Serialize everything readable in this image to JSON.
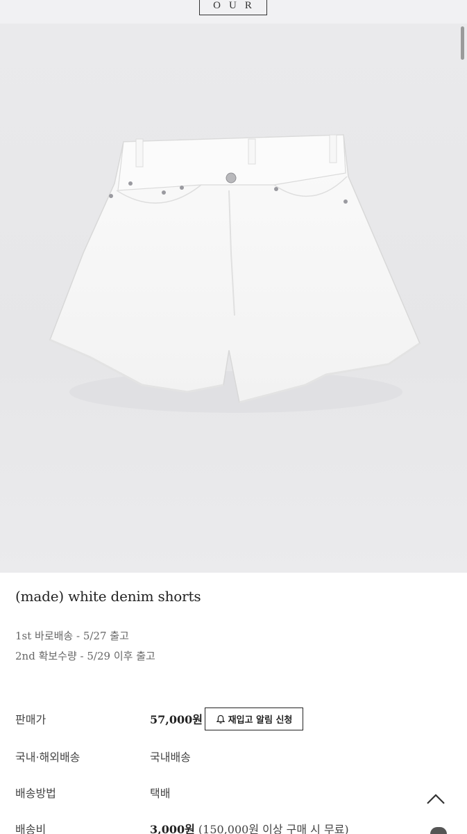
{
  "header": {
    "logo_text": "OUR"
  },
  "product": {
    "image_icon": "white-denim-shorts-photo",
    "title": "(made) white denim shorts",
    "shipping_notes": [
      "1st 바로배송 - 5/27 출고",
      "2nd 확보수량 - 5/29 이후 출고"
    ]
  },
  "details": {
    "price_label": "판매가",
    "price_value": "57,000원",
    "restock_button": "재입고 알림 신청",
    "shipping_type_label": "국내·해외배송",
    "shipping_type_value": "국내배송",
    "shipping_method_label": "배송방법",
    "shipping_method_value": "택배",
    "shipping_fee_label": "배송비",
    "shipping_fee_value": "3,000원",
    "shipping_fee_note": "(150,000원 이상 구매 시 무료)"
  },
  "icons": {
    "bell": "bell-icon",
    "scroll_top": "chevron-up-icon"
  },
  "colors": {
    "background": "#ffffff",
    "hero_bg": "#e8e8ea",
    "text": "#222222"
  }
}
